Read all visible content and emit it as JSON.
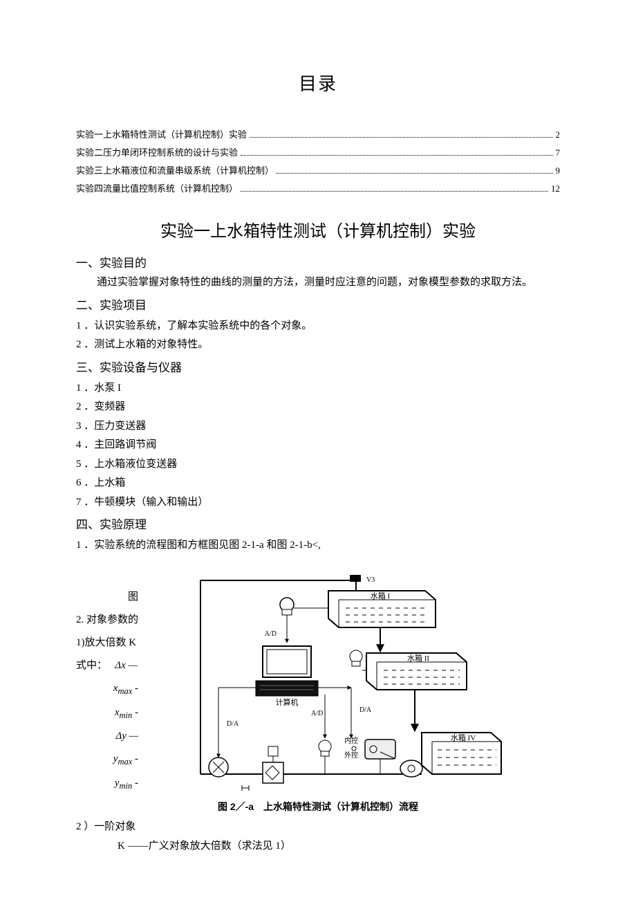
{
  "toc": {
    "heading": "目录",
    "items": [
      {
        "label": "实验一上水箱特性测试（计算机控制）实验",
        "page": "2"
      },
      {
        "label": "实验二压力单闭环控制系统的设计与实验",
        "page": "7"
      },
      {
        "label": "实验三上水箱液位和流量串级系统（计算机控制）",
        "page": "9"
      },
      {
        "label": "实验四流量比值控制系统（计算机控制）",
        "page": "12"
      }
    ]
  },
  "exp1": {
    "title": "实验一上水箱特性测试（计算机控制）实验",
    "s1": {
      "head": "一、实验目的",
      "body": "通过实验掌握对象特性的曲线的测量的方法，测量时应注意的问题，对象模型参数的求取方法。"
    },
    "s2": {
      "head": "二、实验项目",
      "items": [
        "1 ．认识实验系统，了解本实验系统中的各个对象。",
        "2 ．测试上水箱的对象特性。"
      ]
    },
    "s3": {
      "head": "三、实验设备与仪器",
      "items": [
        "1 ．水泵 I",
        "2 ．变频器",
        "3 ．压力变送器",
        "4 ．主回路调节阀",
        "5 ．上水箱液位变送器",
        "6 ．上水箱",
        "7 ．牛顿模块（输入和输出）"
      ]
    },
    "s4": {
      "head": "四、实验原理",
      "line1": "1 ．实验系统的流程图和方框图见图 2-1-a 和图 2-1-b<,"
    },
    "fig": {
      "left_labels": {
        "l0": "图",
        "l1": "2. 对象参数的",
        "l2": "1)放大倍数 K",
        "l3": "式中：",
        "dx": "Δx —",
        "xmax": "x",
        "xmax_sub": "max",
        "xmax_t": " -",
        "xmin": "x",
        "xmin_sub": "min",
        "xmin_t": " -",
        "dy": "Δy —",
        "ymax": "y",
        "ymax_sub": "max",
        "ymax_t": " -",
        "ymin": "y",
        "ymin_sub": "min",
        "ymin_t": " -"
      },
      "diagram": {
        "v3": "V3",
        "tank1": "水箱 I",
        "tank2": "水箱 II",
        "tank4": "水箱 IV",
        "computer": "计算机",
        "ad": "A/D",
        "da": "D/A",
        "internal": "内控",
        "external": "外控"
      },
      "caption": "图 2／-a　上水箱特性测试（计算机控制）流程"
    },
    "after": {
      "line1": "2 ）一阶对象",
      "line2": "K ——广义对象放大倍数（求法见 1）"
    }
  }
}
